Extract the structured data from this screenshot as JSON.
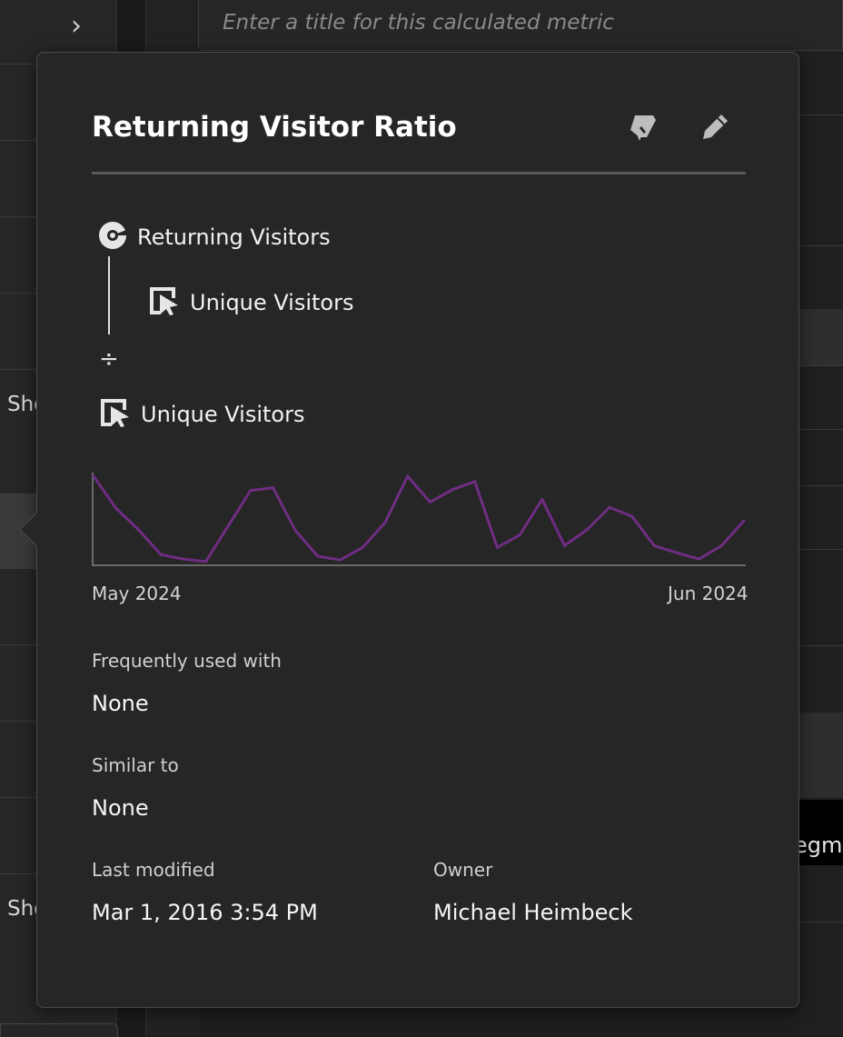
{
  "background": {
    "title_input_placeholder": "Enter a title for this calculated metric",
    "left_row_text_1": "Sho",
    "left_row_text_2": "Sho",
    "right_button_text": "egme"
  },
  "popover": {
    "title": "Returning Visitor Ratio",
    "actions": [
      {
        "name": "approve-icon"
      },
      {
        "name": "edit-icon"
      }
    ],
    "formula": {
      "numerator": {
        "label": "Returning Visitors",
        "icon": "segment-icon"
      },
      "numerator_metric": {
        "label": "Unique Visitors",
        "icon": "metric-icon"
      },
      "operator": "÷",
      "denominator": {
        "label": "Unique Visitors",
        "icon": "metric-icon"
      }
    },
    "sparkline": {
      "start_label": "May 2024",
      "end_label": "Jun 2024"
    },
    "frequently_used_with": {
      "label": "Frequently used with",
      "value": "None"
    },
    "similar_to": {
      "label": "Similar to",
      "value": "None"
    },
    "last_modified": {
      "label": "Last modified",
      "value": "Mar 1, 2016 3:54 PM"
    },
    "owner": {
      "label": "Owner",
      "value": "Michael Heimbeck"
    }
  },
  "chart_data": {
    "type": "line",
    "x": [
      "May 2024",
      "",
      "",
      "",
      "",
      "",
      "",
      "",
      "",
      "",
      "",
      "",
      "",
      "",
      "",
      "",
      "",
      "",
      "",
      "",
      "",
      "",
      "",
      "",
      "",
      "",
      "",
      "",
      "",
      "Jun 2024"
    ],
    "values": [
      0.98,
      0.62,
      0.38,
      0.1,
      0.05,
      0.02,
      0.42,
      0.82,
      0.85,
      0.37,
      0.08,
      0.04,
      0.18,
      0.46,
      0.98,
      0.69,
      0.83,
      0.92,
      0.18,
      0.32,
      0.72,
      0.2,
      0.38,
      0.63,
      0.53,
      0.2,
      0.12,
      0.05,
      0.2,
      0.48
    ],
    "color": "#6f2d82",
    "xlabel": "",
    "ylabel": ""
  },
  "colors": {
    "accent_line": "#6f2d82",
    "popover_bg": "#262626"
  }
}
